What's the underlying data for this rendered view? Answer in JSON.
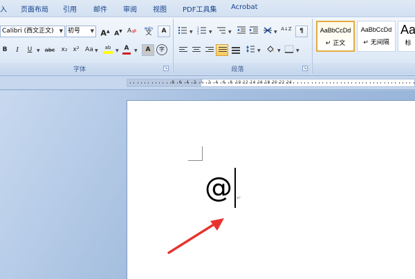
{
  "menu": {
    "tabs": [
      "入",
      "页面布局",
      "引用",
      "邮件",
      "审阅",
      "视图",
      "PDF工具集",
      "Acrobat"
    ]
  },
  "font_group": {
    "font_name": "Calibri (西文正文)",
    "font_size": "初号",
    "grow_font": "A",
    "shrink_font": "A",
    "phonetic": "wén",
    "char_border": "A",
    "bold": "B",
    "italic": "I",
    "underline": "U",
    "strikethrough": "abc",
    "subscript": "x₂",
    "superscript": "x²",
    "change_case": "Aa",
    "highlight": "ab",
    "font_color": "A",
    "char_shading": "A",
    "enclose": "字",
    "label": "字体"
  },
  "paragraph_group": {
    "sort": "A↓Z",
    "label": "段落"
  },
  "styles_group": {
    "cards": [
      {
        "sample": "AaBbCcDd",
        "name": "↵ 正文"
      },
      {
        "sample": "AaBbCcDd",
        "name": "↵ 无间隔"
      },
      {
        "sample": "Aa",
        "name": "标"
      }
    ]
  },
  "ruler": {
    "labels": [
      "8",
      "6",
      "4",
      "2",
      "2",
      "4",
      "6",
      "8",
      "10",
      "12",
      "14",
      "16",
      "18",
      "20",
      "22",
      "24"
    ]
  },
  "document": {
    "content": "@",
    "paragraph_mark": "↵"
  },
  "colors": {
    "accent_arrow": "#e8322e",
    "highlight_yellow": "#ffff00",
    "font_red": "#d02020"
  }
}
